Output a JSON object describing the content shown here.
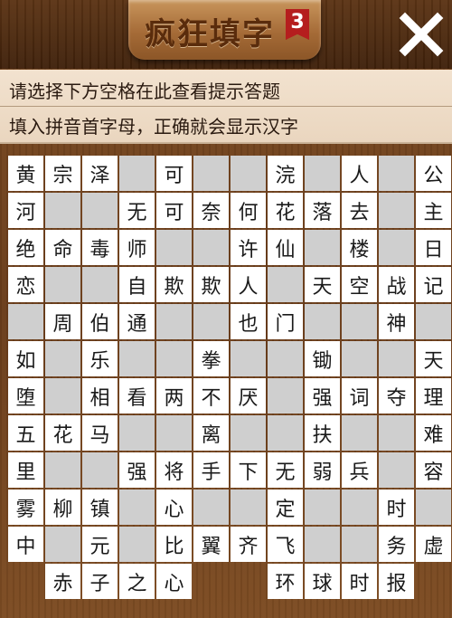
{
  "header": {
    "title": "疯狂填字",
    "level": "3",
    "close_icon": "close-icon"
  },
  "hints": {
    "line1": "请选择下方空格在此查看提示答题",
    "line2": "填入拼音首字母，正确就会显示汉字"
  },
  "colors": {
    "wood": "#6a3d1b",
    "answer_cell": "#ffffff",
    "empty_cell": "#cfcfcf",
    "hint_panel": "#f2e2cf",
    "badge": "#b51e1e"
  },
  "grid": {
    "rows": 12,
    "cols": 12,
    "cells": [
      [
        {
          "t": "w",
          "c": "黄"
        },
        {
          "t": "w",
          "c": "宗"
        },
        {
          "t": "w",
          "c": "泽"
        },
        {
          "t": "g",
          "c": ""
        },
        {
          "t": "w",
          "c": "可"
        },
        {
          "t": "g",
          "c": ""
        },
        {
          "t": "g",
          "c": ""
        },
        {
          "t": "w",
          "c": "浣"
        },
        {
          "t": "g",
          "c": ""
        },
        {
          "t": "w",
          "c": "人"
        },
        {
          "t": "g",
          "c": ""
        },
        {
          "t": "w",
          "c": "公"
        }
      ],
      [
        {
          "t": "w",
          "c": "河"
        },
        {
          "t": "g",
          "c": ""
        },
        {
          "t": "g",
          "c": ""
        },
        {
          "t": "w",
          "c": "无"
        },
        {
          "t": "w",
          "c": "可"
        },
        {
          "t": "w",
          "c": "奈"
        },
        {
          "t": "w",
          "c": "何"
        },
        {
          "t": "w",
          "c": "花"
        },
        {
          "t": "w",
          "c": "落"
        },
        {
          "t": "w",
          "c": "去"
        },
        {
          "t": "g",
          "c": ""
        },
        {
          "t": "w",
          "c": "主"
        }
      ],
      [
        {
          "t": "w",
          "c": "绝"
        },
        {
          "t": "w",
          "c": "命"
        },
        {
          "t": "w",
          "c": "毒"
        },
        {
          "t": "w",
          "c": "师"
        },
        {
          "t": "g",
          "c": ""
        },
        {
          "t": "g",
          "c": ""
        },
        {
          "t": "w",
          "c": "许"
        },
        {
          "t": "w",
          "c": "仙"
        },
        {
          "t": "g",
          "c": ""
        },
        {
          "t": "w",
          "c": "楼"
        },
        {
          "t": "g",
          "c": ""
        },
        {
          "t": "w",
          "c": "日"
        }
      ],
      [
        {
          "t": "w",
          "c": "恋"
        },
        {
          "t": "g",
          "c": ""
        },
        {
          "t": "g",
          "c": ""
        },
        {
          "t": "w",
          "c": "自"
        },
        {
          "t": "w",
          "c": "欺"
        },
        {
          "t": "w",
          "c": "欺"
        },
        {
          "t": "w",
          "c": "人"
        },
        {
          "t": "g",
          "c": ""
        },
        {
          "t": "w",
          "c": "天"
        },
        {
          "t": "w",
          "c": "空"
        },
        {
          "t": "w",
          "c": "战"
        },
        {
          "t": "w",
          "c": "记"
        }
      ],
      [
        {
          "t": "g",
          "c": ""
        },
        {
          "t": "w",
          "c": "周"
        },
        {
          "t": "w",
          "c": "伯"
        },
        {
          "t": "w",
          "c": "通"
        },
        {
          "t": "g",
          "c": ""
        },
        {
          "t": "g",
          "c": ""
        },
        {
          "t": "w",
          "c": "也"
        },
        {
          "t": "w",
          "c": "门"
        },
        {
          "t": "g",
          "c": ""
        },
        {
          "t": "g",
          "c": ""
        },
        {
          "t": "w",
          "c": "神"
        },
        {
          "t": "g",
          "c": ""
        }
      ],
      [
        {
          "t": "w",
          "c": "如"
        },
        {
          "t": "g",
          "c": ""
        },
        {
          "t": "w",
          "c": "乐"
        },
        {
          "t": "g",
          "c": ""
        },
        {
          "t": "g",
          "c": ""
        },
        {
          "t": "w",
          "c": "拳"
        },
        {
          "t": "g",
          "c": ""
        },
        {
          "t": "g",
          "c": ""
        },
        {
          "t": "w",
          "c": "锄"
        },
        {
          "t": "g",
          "c": ""
        },
        {
          "t": "g",
          "c": ""
        },
        {
          "t": "w",
          "c": "天"
        }
      ],
      [
        {
          "t": "w",
          "c": "堕"
        },
        {
          "t": "g",
          "c": ""
        },
        {
          "t": "w",
          "c": "相"
        },
        {
          "t": "w",
          "c": "看"
        },
        {
          "t": "w",
          "c": "两"
        },
        {
          "t": "w",
          "c": "不"
        },
        {
          "t": "w",
          "c": "厌"
        },
        {
          "t": "g",
          "c": ""
        },
        {
          "t": "w",
          "c": "强"
        },
        {
          "t": "w",
          "c": "词"
        },
        {
          "t": "w",
          "c": "夺"
        },
        {
          "t": "w",
          "c": "理"
        }
      ],
      [
        {
          "t": "w",
          "c": "五"
        },
        {
          "t": "w",
          "c": "花"
        },
        {
          "t": "w",
          "c": "马"
        },
        {
          "t": "g",
          "c": ""
        },
        {
          "t": "g",
          "c": ""
        },
        {
          "t": "w",
          "c": "离"
        },
        {
          "t": "g",
          "c": ""
        },
        {
          "t": "g",
          "c": ""
        },
        {
          "t": "w",
          "c": "扶"
        },
        {
          "t": "g",
          "c": ""
        },
        {
          "t": "g",
          "c": ""
        },
        {
          "t": "w",
          "c": "难"
        }
      ],
      [
        {
          "t": "w",
          "c": "里"
        },
        {
          "t": "g",
          "c": ""
        },
        {
          "t": "g",
          "c": ""
        },
        {
          "t": "w",
          "c": "强"
        },
        {
          "t": "w",
          "c": "将"
        },
        {
          "t": "w",
          "c": "手"
        },
        {
          "t": "w",
          "c": "下"
        },
        {
          "t": "w",
          "c": "无"
        },
        {
          "t": "w",
          "c": "弱"
        },
        {
          "t": "w",
          "c": "兵"
        },
        {
          "t": "g",
          "c": ""
        },
        {
          "t": "w",
          "c": "容"
        }
      ],
      [
        {
          "t": "w",
          "c": "雾"
        },
        {
          "t": "w",
          "c": "柳"
        },
        {
          "t": "w",
          "c": "镇"
        },
        {
          "t": "g",
          "c": ""
        },
        {
          "t": "w",
          "c": "心"
        },
        {
          "t": "g",
          "c": ""
        },
        {
          "t": "g",
          "c": ""
        },
        {
          "t": "w",
          "c": "定"
        },
        {
          "t": "g",
          "c": ""
        },
        {
          "t": "g",
          "c": ""
        },
        {
          "t": "w",
          "c": "时"
        },
        {
          "t": "g",
          "c": ""
        }
      ],
      [
        {
          "t": "w",
          "c": "中"
        },
        {
          "t": "g",
          "c": ""
        },
        {
          "t": "w",
          "c": "元"
        },
        {
          "t": "g",
          "c": ""
        },
        {
          "t": "w",
          "c": "比"
        },
        {
          "t": "w",
          "c": "翼"
        },
        {
          "t": "w",
          "c": "齐"
        },
        {
          "t": "w",
          "c": "飞"
        },
        {
          "t": "g",
          "c": ""
        },
        {
          "t": "g",
          "c": ""
        },
        {
          "t": "w",
          "c": "务"
        },
        {
          "t": "w",
          "c": "虚"
        }
      ],
      [
        {
          "t": "b",
          "c": ""
        },
        {
          "t": "w",
          "c": "赤"
        },
        {
          "t": "w",
          "c": "子"
        },
        {
          "t": "w",
          "c": "之"
        },
        {
          "t": "w",
          "c": "心"
        },
        {
          "t": "b",
          "c": ""
        },
        {
          "t": "b",
          "c": ""
        },
        {
          "t": "w",
          "c": "环"
        },
        {
          "t": "w",
          "c": "球"
        },
        {
          "t": "w",
          "c": "时"
        },
        {
          "t": "w",
          "c": "报"
        },
        {
          "t": "b",
          "c": ""
        }
      ]
    ]
  }
}
